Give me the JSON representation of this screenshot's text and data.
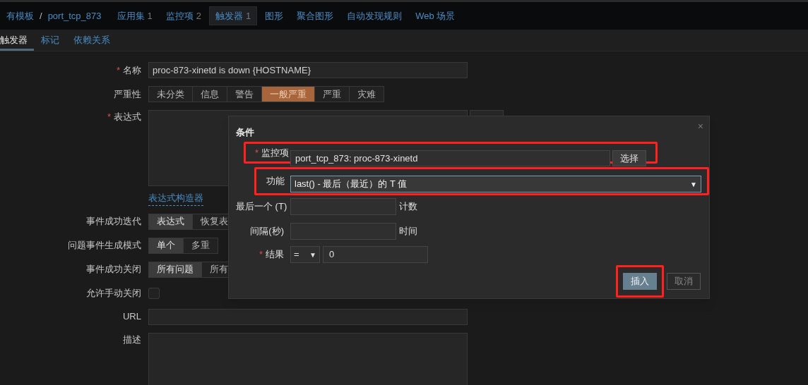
{
  "required_mark": "*",
  "breadcrumbs": [
    {
      "label": "有模板",
      "selected": false
    },
    {
      "label": "port_tcp_873",
      "selected": false
    },
    {
      "label": "应用集",
      "count": "1",
      "selected": false
    },
    {
      "label": "监控项",
      "count": "2",
      "selected": false
    },
    {
      "label": "触发器",
      "count": "1",
      "selected": true
    },
    {
      "label": "图形",
      "selected": false
    },
    {
      "label": "聚合图形",
      "selected": false
    },
    {
      "label": "自动发现规则",
      "selected": false
    },
    {
      "label": "Web 场景",
      "selected": false
    }
  ],
  "breadcrumb_separator": "/",
  "tabs": [
    {
      "label": "触发器",
      "selected": true
    },
    {
      "label": "标记",
      "selected": false
    },
    {
      "label": "依赖关系",
      "selected": false
    }
  ],
  "form": {
    "name": {
      "label": "名称",
      "required": true,
      "value": "proc-873-xinetd is down {HOSTNAME}"
    },
    "severity": {
      "label": "严重性",
      "options": [
        {
          "label": "未分类",
          "selected": false
        },
        {
          "label": "信息",
          "selected": false
        },
        {
          "label": "警告",
          "selected": false
        },
        {
          "label": "一般严重",
          "selected": true
        },
        {
          "label": "严重",
          "selected": false
        },
        {
          "label": "灾难",
          "selected": false
        }
      ]
    },
    "expression": {
      "label": "表达式",
      "required": true,
      "builder_link": "表达式构造器"
    },
    "ok_event_generation": {
      "label": "事件成功迭代",
      "options": [
        {
          "label": "表达式",
          "selected": true
        },
        {
          "label": "恢复表",
          "selected": false
        }
      ]
    },
    "problem_event_mode": {
      "label": "问题事件生成模式",
      "options": [
        {
          "label": "单个",
          "selected": true
        },
        {
          "label": "多重",
          "selected": false
        }
      ]
    },
    "ok_event_closes": {
      "label": "事件成功关闭",
      "options": [
        {
          "label": "所有问题",
          "selected": true
        },
        {
          "label": "所有",
          "selected": false
        }
      ]
    },
    "allow_manual_close": {
      "label": "允许手动关闭",
      "checked": false
    },
    "url": {
      "label": "URL"
    },
    "description": {
      "label": "描述"
    }
  },
  "dialog": {
    "title": "条件",
    "close": "×",
    "item": {
      "label": "监控项",
      "required": true,
      "value": "port_tcp_873: proc-873-xinetd",
      "button": "选择",
      "highlighted": true
    },
    "function": {
      "label": "功能",
      "value": "last() - 最后（最近）的 T 值",
      "arrow": "▼",
      "highlighted": true
    },
    "last_t": {
      "label": "最后一个 (T)",
      "suffix": "计数"
    },
    "interval": {
      "label": "间隔(秒)",
      "suffix": "时间"
    },
    "result": {
      "label": "结果",
      "required": true,
      "operator": "=",
      "arrow": "▼",
      "value": "0"
    },
    "buttons": [
      {
        "label": "插入",
        "kind": "primary",
        "highlighted": true
      },
      {
        "label": "取消",
        "kind": "secondary",
        "highlighted": false
      }
    ]
  }
}
